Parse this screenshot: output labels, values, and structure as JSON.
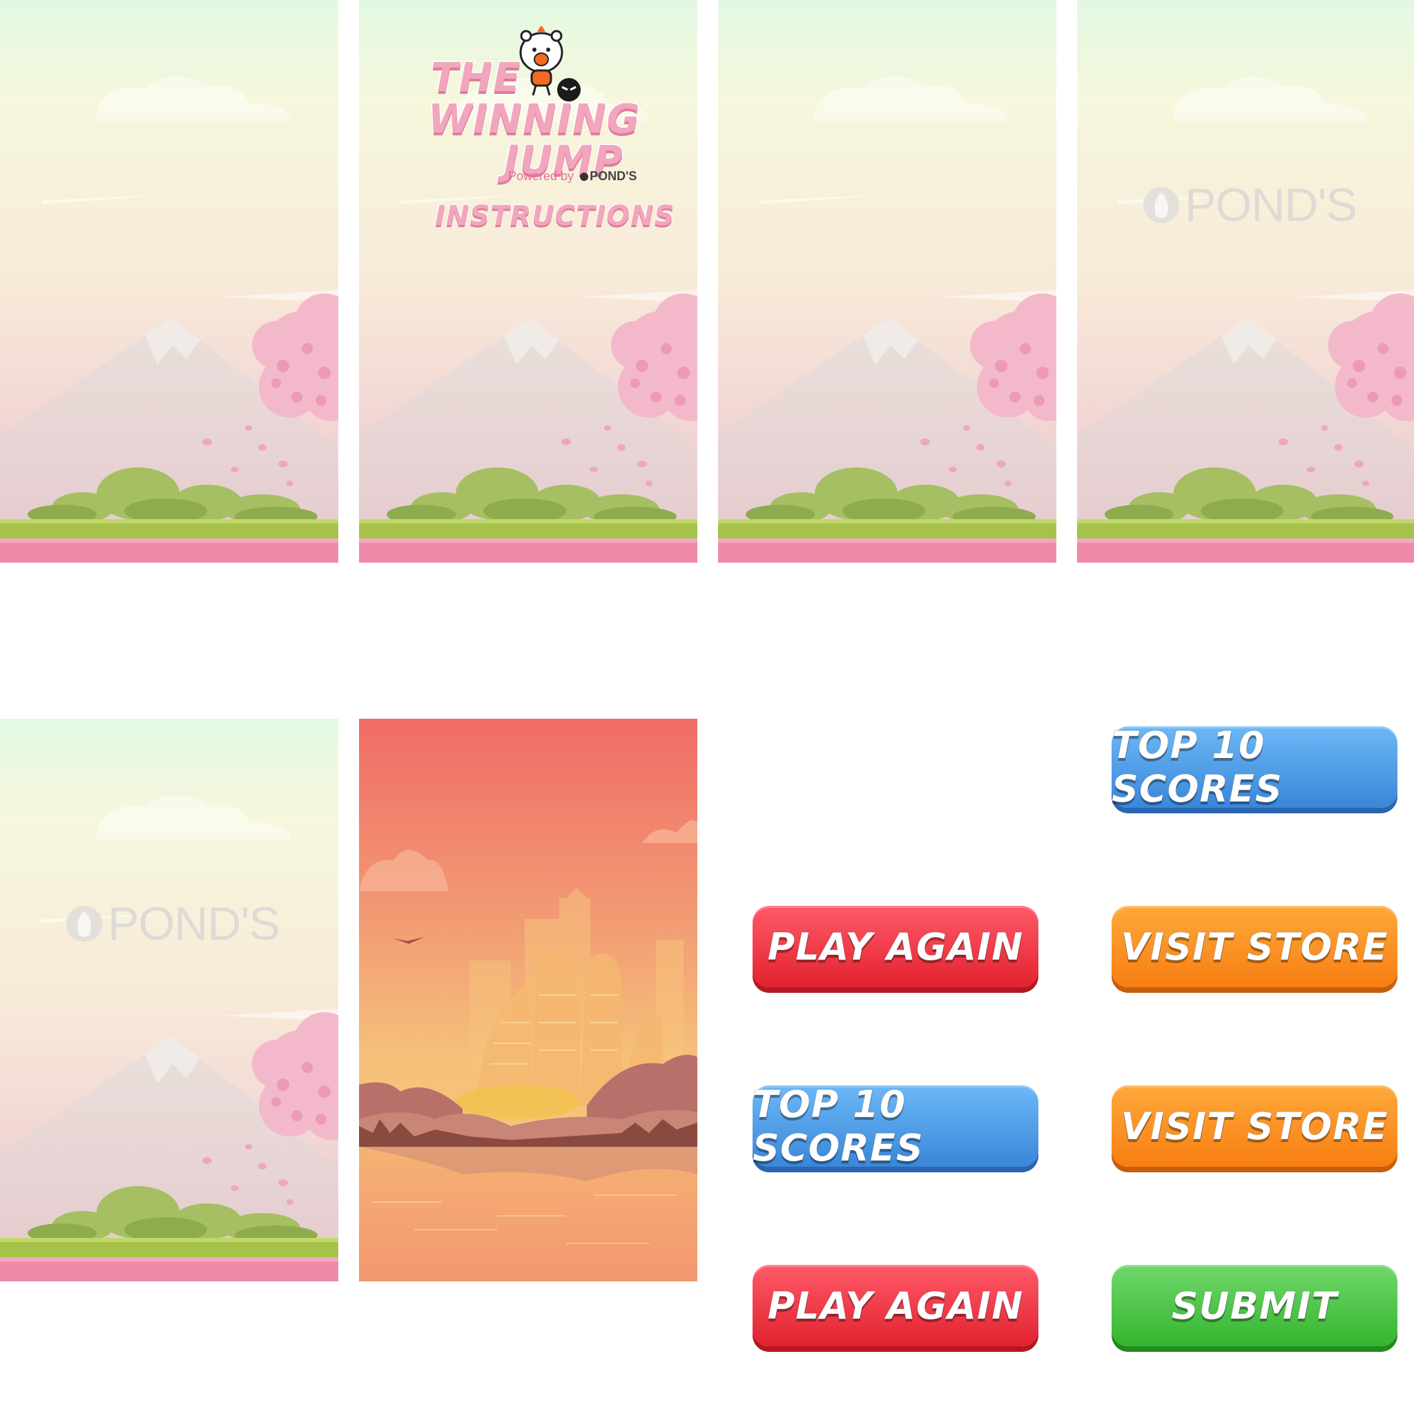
{
  "title_screen": {
    "title_line1": "THE",
    "title_line2": "WINNING",
    "title_line3": "JUMP",
    "powered_by": "Powered by",
    "powered_brand": "POND'S",
    "instructions_label": "INSTRUCTIONS"
  },
  "brand_logo": {
    "text": "POND'S"
  },
  "buttons": {
    "top_scores_label": "TOP 10 SCORES",
    "play_again_label": "PLAY AGAIN",
    "visit_store_label": "VISIT STORE",
    "submit_label": "SUBMIT"
  },
  "colors": {
    "pink_title": "#f2a6bd",
    "red_button": "#e2222f",
    "blue_button": "#3a86d8",
    "orange_button": "#f77e12",
    "green_button": "#34b52e"
  }
}
